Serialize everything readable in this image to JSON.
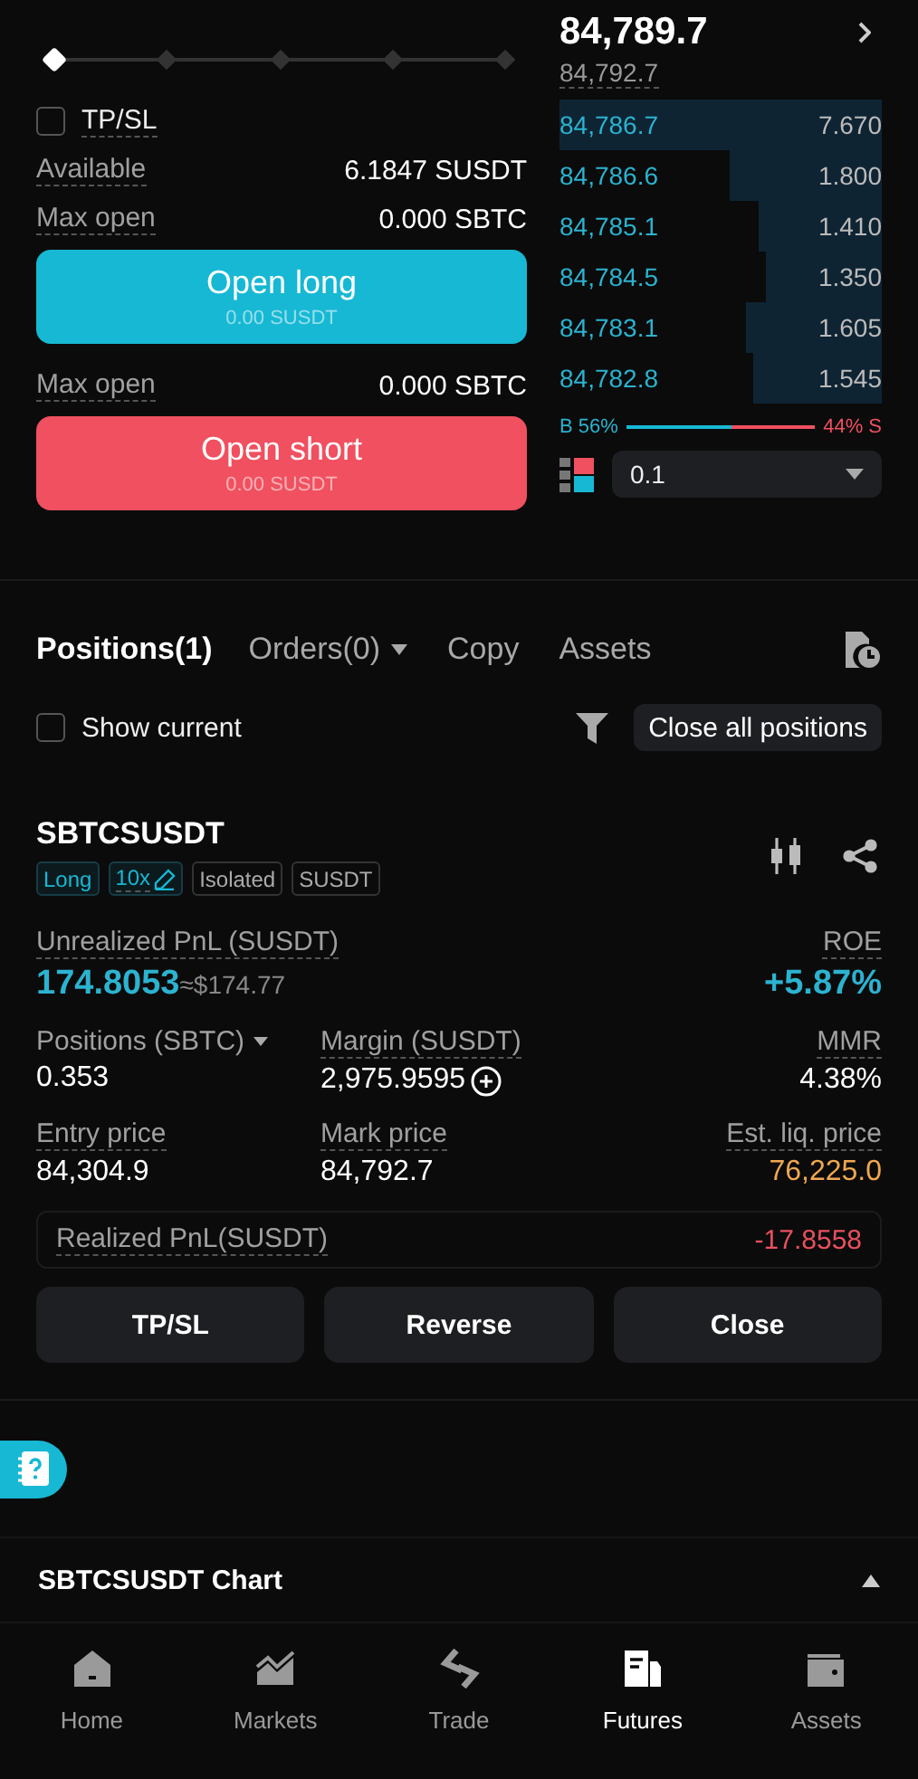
{
  "leverage_slider": {
    "level": 0
  },
  "tpsl": {
    "label": "TP/SL",
    "checked": false
  },
  "available": {
    "label": "Available",
    "value": "6.1847 SUSDT"
  },
  "long": {
    "max_label": "Max open",
    "max_value": "0.000 SBTC",
    "button": "Open long",
    "amount": "0.00 SUSDT"
  },
  "short": {
    "max_label": "Max open",
    "max_value": "0.000 SBTC",
    "button": "Open short",
    "amount": "0.00 SUSDT"
  },
  "ticker": {
    "last": "84,789.7",
    "mark": "84,792.7"
  },
  "order_book": [
    {
      "price": "84,786.7",
      "qty": "7.670"
    },
    {
      "price": "84,786.6",
      "qty": "1.800"
    },
    {
      "price": "84,785.1",
      "qty": "1.410"
    },
    {
      "price": "84,784.5",
      "qty": "1.350"
    },
    {
      "price": "84,783.1",
      "qty": "1.605"
    },
    {
      "price": "84,782.8",
      "qty": "1.545"
    }
  ],
  "ratio": {
    "buy": "B 56%",
    "sell": "44% S",
    "level": 0.56
  },
  "precision": "0.1",
  "tabs": [
    {
      "label": "Positions(1)",
      "selected": true
    },
    {
      "label": "Orders(0)",
      "selected": false
    },
    {
      "label": "Copy",
      "selected": false
    },
    {
      "label": "Assets",
      "selected": false
    }
  ],
  "show_current": {
    "label": "Show current",
    "checked": false
  },
  "close_all": "Close all positions",
  "position": {
    "symbol": "SBTCSUSDT",
    "tags": [
      {
        "label": "Long",
        "kind": "accent"
      },
      {
        "label": "10x",
        "kind": "editable"
      },
      {
        "label": "Isolated",
        "kind": "plain"
      },
      {
        "label": "SUSDT",
        "kind": "plain"
      }
    ],
    "unrealized": {
      "label": "Unrealized PnL (SUSDT)",
      "value": "174.8053",
      "approx": "≈$174.77"
    },
    "roe": {
      "label": "ROE",
      "value": "+5.87%"
    },
    "size": {
      "label": "Positions (SBTC)",
      "value": "0.353"
    },
    "margin": {
      "label": "Margin (SUSDT)",
      "value": "2,975.9595"
    },
    "mmr": {
      "label": "MMR",
      "value": "4.38%"
    },
    "entry": {
      "label": "Entry price",
      "value": "84,304.9"
    },
    "mark": {
      "label": "Mark price",
      "value": "84,792.7"
    },
    "liq": {
      "label": "Est. liq. price",
      "value": "76,225.0"
    },
    "realized": {
      "label": "Realized PnL(SUSDT)",
      "value": "-17.8558"
    },
    "actions": [
      "TP/SL",
      "Reverse",
      "Close"
    ]
  },
  "chart_bar": {
    "title": "SBTCSUSDT Chart",
    "expanded": true
  },
  "nav": [
    {
      "label": "Home",
      "selected": false
    },
    {
      "label": "Markets",
      "selected": false
    },
    {
      "label": "Trade",
      "selected": false
    },
    {
      "label": "Futures",
      "selected": true
    },
    {
      "label": "Assets",
      "selected": false
    }
  ]
}
